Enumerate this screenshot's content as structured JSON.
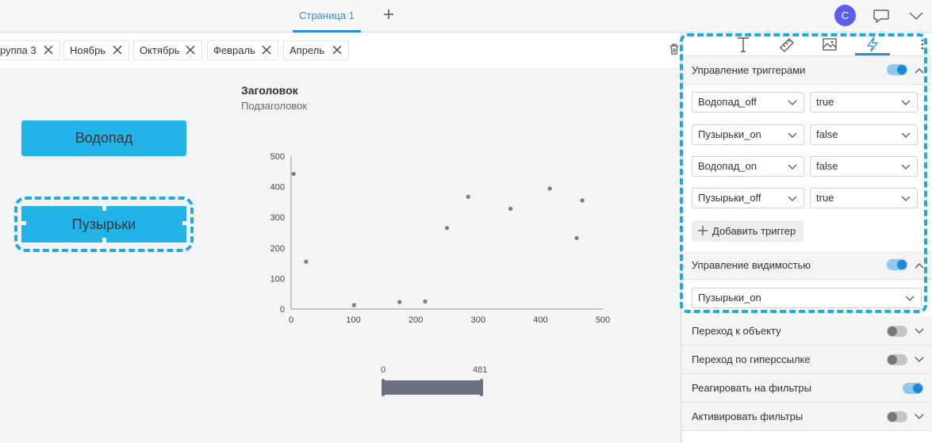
{
  "topbar": {
    "page_tab": "Страница 1",
    "add_tab": "+",
    "avatar_letter": "С"
  },
  "filters": [
    {
      "label": "руппа 3"
    },
    {
      "label": "Ноябрь"
    },
    {
      "label": "Октябрь"
    },
    {
      "label": "Февраль"
    },
    {
      "label": "Апрель"
    }
  ],
  "canvas": {
    "button_waterfall": "Водопад",
    "button_bubbles": "Пузырьки",
    "chart_title": "Заголовок",
    "chart_subtitle": "Подзаголовок",
    "slider_min": "0",
    "slider_max": "481"
  },
  "chart_data": {
    "type": "scatter",
    "xlim": [
      0,
      500
    ],
    "ylim": [
      0,
      500
    ],
    "xticks": [
      "0",
      "100",
      "200",
      "300",
      "400",
      "500"
    ],
    "yticks": [
      "0",
      "100",
      "200",
      "300",
      "400",
      "500"
    ],
    "points": [
      {
        "x": 4,
        "y": 442
      },
      {
        "x": 24,
        "y": 155
      },
      {
        "x": 101,
        "y": 13
      },
      {
        "x": 174,
        "y": 23
      },
      {
        "x": 215,
        "y": 25
      },
      {
        "x": 250,
        "y": 265
      },
      {
        "x": 284,
        "y": 367
      },
      {
        "x": 352,
        "y": 328
      },
      {
        "x": 415,
        "y": 394
      },
      {
        "x": 458,
        "y": 232
      },
      {
        "x": 467,
        "y": 355
      }
    ],
    "point_color": "#7a7a8c"
  },
  "panel": {
    "triggers_title": "Управление триггерами",
    "triggers": [
      {
        "name": "Водопад_off",
        "value": "true"
      },
      {
        "name": "Пузырьки_on",
        "value": "false"
      },
      {
        "name": "Водопад_on",
        "value": "false"
      },
      {
        "name": "Пузырьки_off",
        "value": "true"
      }
    ],
    "add_trigger": "Добавить триггер",
    "visibility_title": "Управление видимостью",
    "visibility_value": "Пузырьки_on",
    "rows": [
      {
        "label": "Переход к объекту",
        "on": false
      },
      {
        "label": "Переход по гиперссылке",
        "on": false
      },
      {
        "label": "Реагировать на фильтры",
        "on": true
      },
      {
        "label": "Активировать фильтры",
        "on": false
      }
    ]
  },
  "colors": {
    "accent": "#2a8fd6",
    "button": "#22b4e8",
    "selection": "#20a9e1"
  }
}
